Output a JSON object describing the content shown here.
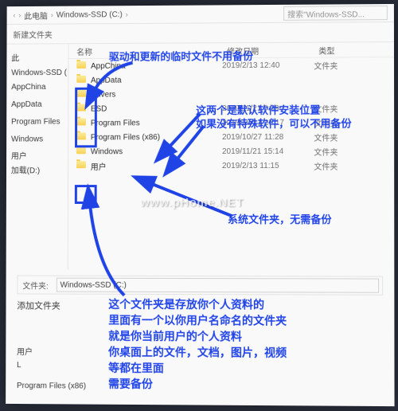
{
  "breadcrumb": {
    "item1": "此电脑",
    "item2": "Windows-SSD (C:)"
  },
  "search": {
    "placeholder": "搜索\"Windows-SSD..."
  },
  "toolbar": {
    "newfolder": "新建文件夹"
  },
  "columns": {
    "name": "名称",
    "date": "修改日期",
    "type": "类型"
  },
  "folders": [
    {
      "name": "AppChina",
      "date": "2019/2/13 12:40",
      "type": "文件夹"
    },
    {
      "name": "AppData",
      "date": "",
      "type": ""
    },
    {
      "name": "Drivers",
      "date": "",
      "type": ""
    },
    {
      "name": "ESD",
      "date": "2019/11/21 0:39",
      "type": "文件夹"
    },
    {
      "name": "Program Files",
      "date": "2019/10/13 15:17",
      "type": "文件夹"
    },
    {
      "name": "Program Files (x86)",
      "date": "2019/10/27 11:28",
      "type": "文件夹"
    },
    {
      "name": "Windows",
      "date": "2019/11/21 15:14",
      "type": "文件夹"
    },
    {
      "name": "用户",
      "date": "2019/2/13 11:15",
      "type": "文件夹"
    }
  ],
  "sidebar": {
    "items": [
      "",
      "此",
      "Windows-SSD (",
      "AppChina",
      "",
      "AppData",
      "",
      "Program Files",
      "",
      "Windows",
      "",
      "用户",
      "加载(D:)"
    ]
  },
  "pathbar": {
    "label": "文件夹:",
    "value": "Windows-SSD (C:)"
  },
  "lower": {
    "title": "添加文件夹",
    "items": [
      "用户",
      "L",
      "Program Files (x86)"
    ]
  },
  "annotations": {
    "top": "驱动和更新的临时文件不用备份",
    "mid1": "这两个是默认软件安装位置",
    "mid2": "如果没有特殊软件，可以不用备份",
    "sys": "系统文件夹，无需备份",
    "bottom": [
      "这个文件夹是存放你个人资料的",
      "里面有一个以你用户名命名的文件夹",
      "就是你当前用户的个人资料",
      "你桌面上的文件，文档，图片，视频",
      "等都在里面",
      "需要备份"
    ]
  },
  "watermark": "www.pHome.NET"
}
